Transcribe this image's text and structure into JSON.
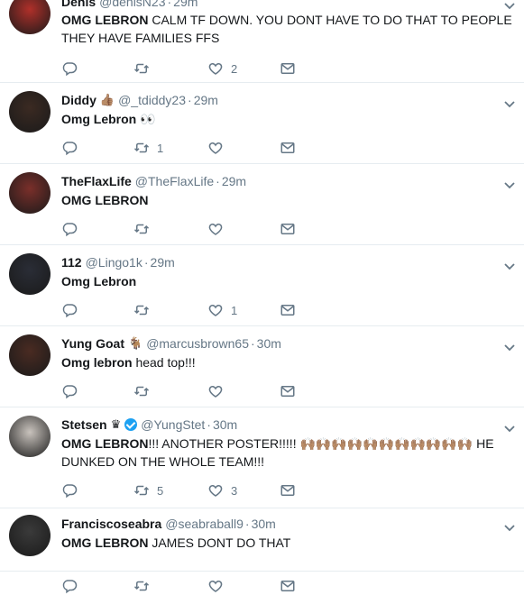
{
  "tweets": [
    {
      "name": "Denis",
      "handle": "@denisN23",
      "time": "29m",
      "text_bold": "OMG LEBRON",
      "text_rest": " CALM TF DOWN. YOU DONT HAVE TO DO THAT TO PEOPLE THEY HAVE FAMILIES FFS",
      "replies": "",
      "retweets": "",
      "likes": "2",
      "avatar_color": "#b0302a"
    },
    {
      "name": "Diddy",
      "name_emoji": "👍🏽",
      "handle": "@_tdiddy23",
      "time": "29m",
      "text_bold": "Omg Lebron",
      "text_rest": " 👀",
      "replies": "",
      "retweets": "1",
      "likes": "",
      "avatar_color": "#3b2a22"
    },
    {
      "name": "TheFlaxLife",
      "handle": "@TheFlaxLife",
      "time": "29m",
      "text_bold": "OMG LEBRON",
      "text_rest": "",
      "replies": "",
      "retweets": "",
      "likes": "",
      "avatar_color": "#7a2f2a"
    },
    {
      "name": "112",
      "handle": "@Lingo1k",
      "time": "29m",
      "text_bold": "Omg Lebron",
      "text_rest": "",
      "replies": "",
      "retweets": "",
      "likes": "1",
      "avatar_color": "#2a2d36"
    },
    {
      "name": "Yung Goat",
      "name_emoji": "🐐",
      "handle": "@marcusbrown65",
      "time": "30m",
      "text_bold": "Omg lebron",
      "text_rest": " head top!!!",
      "replies": "",
      "retweets": "",
      "likes": "",
      "avatar_color": "#4a2b22"
    },
    {
      "name": "Stetsen",
      "name_emoji": "♛",
      "verified": true,
      "handle": "@YungStet",
      "time": "30m",
      "text_bold": "OMG LEBRON",
      "text_rest": "!!! ANOTHER POSTER!!!!! 🙌🏽🙌🏽🙌🏽🙌🏽🙌🏽🙌🏽🙌🏽🙌🏽🙌🏽🙌🏽🙌🏽 HE DUNKED ON THE WHOLE TEAM!!!",
      "replies": "",
      "retweets": "5",
      "likes": "3",
      "avatar_color": "#c9c3bd"
    },
    {
      "name": "Franciscoseabra",
      "handle": "@seabraball9",
      "time": "30m",
      "text_bold": "OMG LEBRON",
      "text_rest": " JAMES DONT DO THAT",
      "replies": "",
      "retweets": "",
      "likes": "",
      "avatar_color": "#3a3a3a"
    }
  ],
  "colors": {
    "secondary_text": "#657786",
    "primary_text": "#14171a",
    "verified": "#1da1f2",
    "divider": "#e6ecf0"
  },
  "icons": {
    "reply": "reply-icon",
    "retweet": "retweet-icon",
    "like": "heart-icon",
    "dm": "envelope-icon",
    "menu": "chevron-down-icon"
  }
}
